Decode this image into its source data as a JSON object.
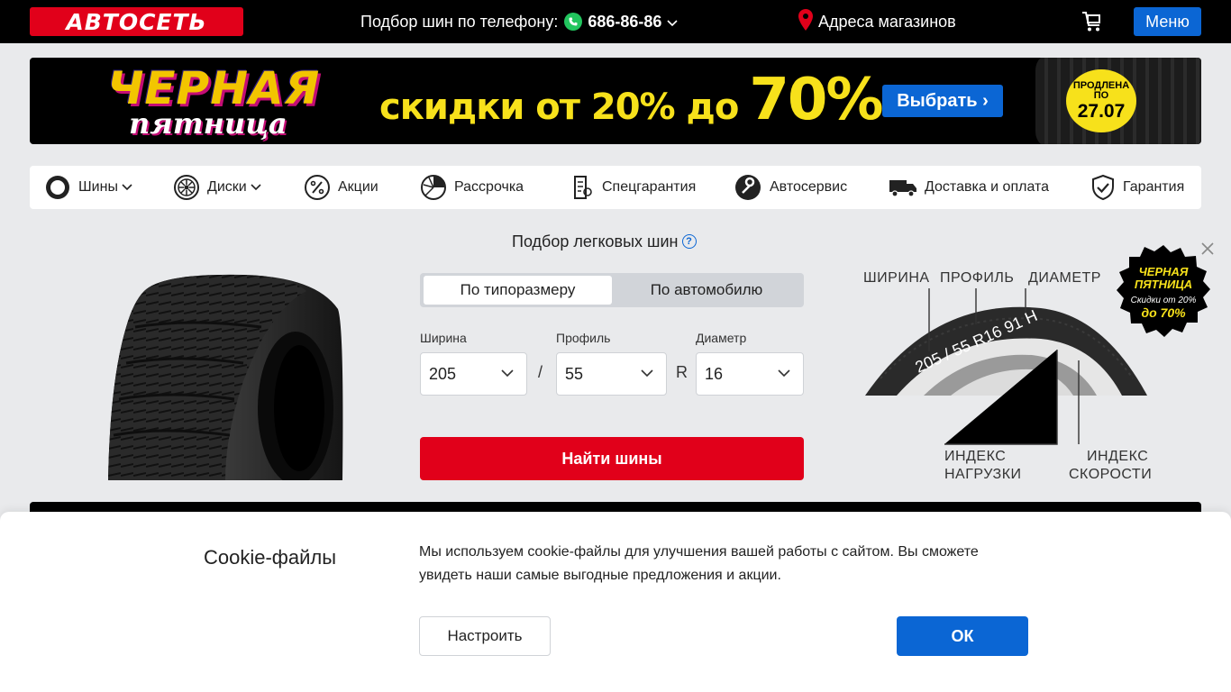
{
  "header": {
    "logo_text": "АВТОСЕТЬ",
    "phone_label": "Подбор шин по телефону:",
    "phone_number": "686-86-86",
    "stores_label": "Адреса магазинов",
    "menu_label": "Меню"
  },
  "banner": {
    "title_line1": "ЧЕРНАЯ",
    "title_line2": "пятница",
    "discount_text": "скидки от 20% до",
    "discount_big": "70%",
    "choose_label": "Выбрать ›",
    "extended_line1": "ПРОДЛЕНА",
    "extended_line2": "ПО",
    "extended_date": "27.07"
  },
  "nav": {
    "items": [
      {
        "label": "Шины",
        "icon": "tire-icon"
      },
      {
        "label": "Диски",
        "icon": "wheel-rim-icon"
      },
      {
        "label": "Акции",
        "icon": "percent-icon"
      },
      {
        "label": "Рассрочка",
        "icon": "installment-icon"
      },
      {
        "label": "Спецгарантия",
        "icon": "special-warranty-icon"
      },
      {
        "label": "Автосервис",
        "icon": "wrench-icon"
      },
      {
        "label": "Доставка и оплата",
        "icon": "truck-icon"
      },
      {
        "label": "Гарантия",
        "icon": "shield-check-icon"
      }
    ]
  },
  "selector": {
    "title": "Подбор легковых шин",
    "help": "?",
    "tabs": [
      "По типоразмеру",
      "По автомобилю"
    ],
    "width_label": "Ширина",
    "profile_label": "Профиль",
    "diameter_label": "Диаметр",
    "width_value": "205",
    "profile_value": "55",
    "diameter_value": "16",
    "separator": "/",
    "r_label": "R",
    "find_label": "Найти шины"
  },
  "diagram": {
    "width": "ШИРИНА",
    "profile": "ПРОФИЛЬ",
    "diameter": "ДИАМЕТР",
    "tire_marking": "205 / 55  R16  91 H",
    "load_index_1": "ИНДЕКС",
    "load_index_2": "НАГРУЗКИ",
    "speed_index_1": "ИНДЕКС",
    "speed_index_2": "СКОРОСТИ"
  },
  "promo_badge": {
    "line1": "ЧЕРНАЯ",
    "line2": "ПЯТНИЦА",
    "line3": "Скидки от 20%",
    "line4": "до 70%"
  },
  "cookie": {
    "title": "Cookie-файлы",
    "text": "Мы используем cookie-файлы для улучшения вашей работы с сайтом. Вы сможете увидеть наши самые выгодные предложения и акции.",
    "setup_label": "Настроить",
    "ok_label": "ОК"
  },
  "colors": {
    "brand_red": "#e1001a",
    "accent_blue": "#0b66d4",
    "banner_yellow": "#f7e11b"
  }
}
